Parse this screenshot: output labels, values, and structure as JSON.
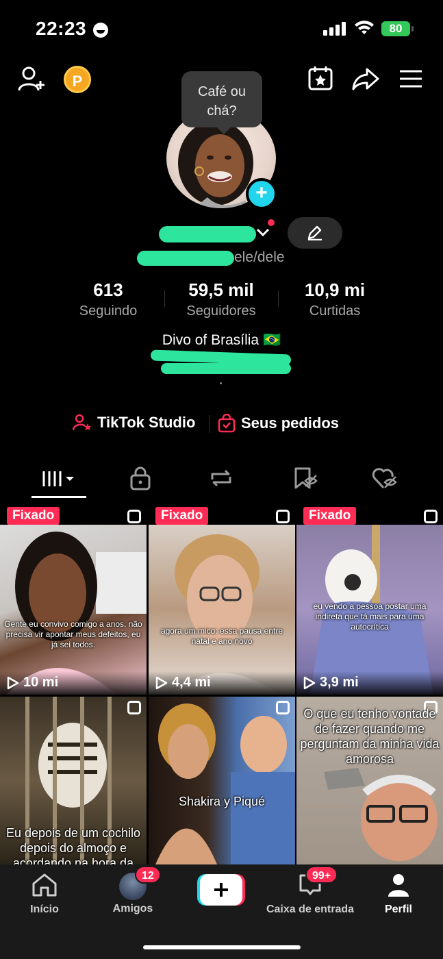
{
  "status_bar": {
    "time": "22:23",
    "battery": "80"
  },
  "avatar": {
    "tooltip": "Café ou chá?"
  },
  "profile": {
    "pronouns": "ele/dele",
    "bio": "Divo of Brasília 🇧🇷"
  },
  "stats": [
    {
      "value": "613",
      "label": "Seguindo"
    },
    {
      "value": "59,5 mil",
      "label": "Seguidores"
    },
    {
      "value": "10,9 mi",
      "label": "Curtidas"
    }
  ],
  "links": {
    "studio": "TikTok Studio",
    "orders": "Seus pedidos"
  },
  "coin_label": "P",
  "videos": [
    {
      "pinned": "Fixado",
      "views": "10 mi",
      "caption": "Gente eu convivo comigo a anos, não precisa vir apontar meus defeitos, eu já sei todos."
    },
    {
      "pinned": "Fixado",
      "views": "4,4 mi",
      "caption": "agora um mico: essa pausa entre natal e ano novo"
    },
    {
      "pinned": "Fixado",
      "views": "3,9 mi",
      "caption": "eu vendo a pessoa postar uma indireta que tá mais para uma autocrítica"
    },
    {
      "caption": "Eu depois de um cochilo depois do almoço e acordando na hora da"
    },
    {
      "caption": "Shakira y Piqué"
    },
    {
      "caption": "O que eu tenho vontade de fazer quando me perguntam da minha vida amorosa"
    }
  ],
  "nav": {
    "home": "Início",
    "friends": "Amigos",
    "friends_badge": "12",
    "inbox": "Caixa de entrada",
    "inbox_badge": "99+",
    "profile": "Perfil"
  }
}
